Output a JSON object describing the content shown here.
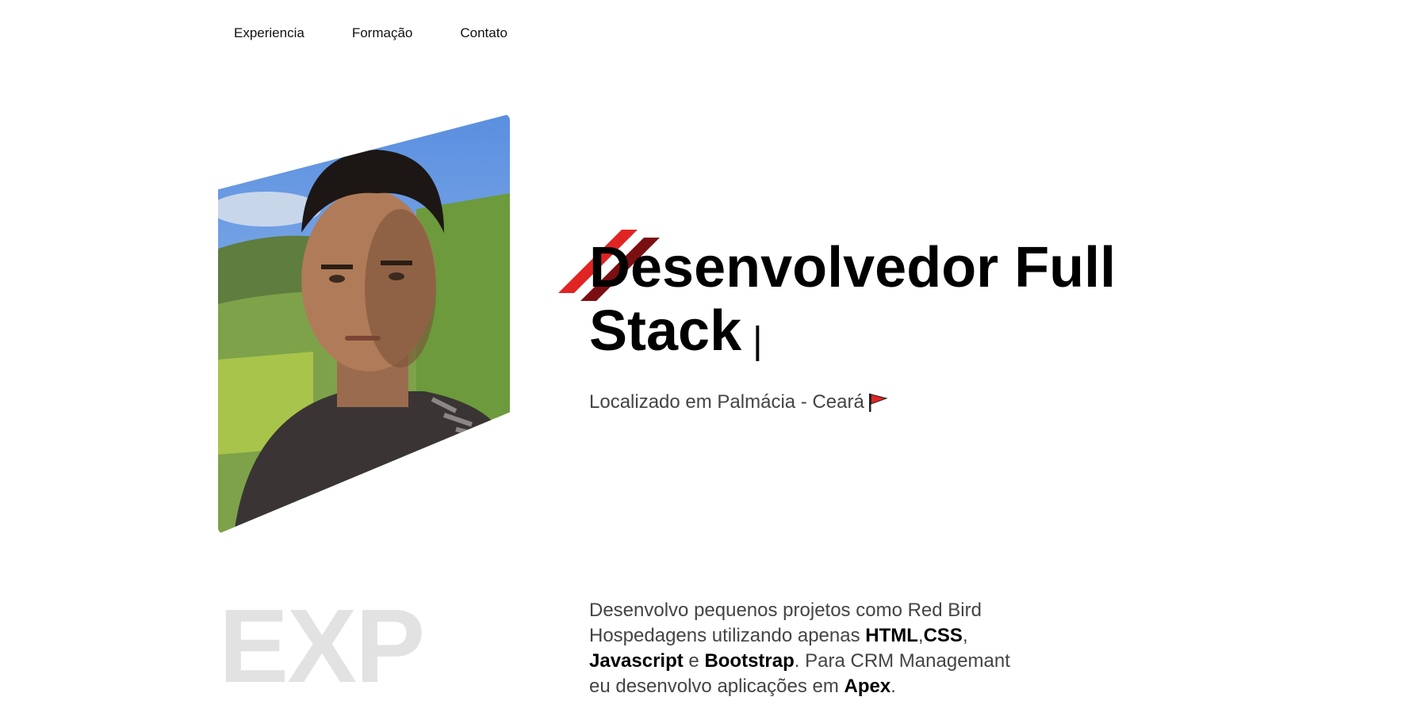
{
  "nav": {
    "items": [
      {
        "label": "Experiencia"
      },
      {
        "label": "Formação"
      },
      {
        "label": "Contato"
      }
    ]
  },
  "hero": {
    "title": "Desenvolvedor Full Stack",
    "caret": "|",
    "location": "Localizado em Palmácia - Ceará",
    "flag_icon": "red-flag-icon",
    "accent_colors": {
      "light_red": "#e02424",
      "dark_red": "#7a0f12"
    }
  },
  "experience": {
    "big_label": "EXP",
    "description": {
      "t1": "Desenvolvo pequenos projetos como Red Bird Hospedagens utilizando apenas ",
      "html": "HTML",
      "comma1": ",",
      "css": "CSS",
      "comma2": ", ",
      "js": "Javascript",
      "and": " e ",
      "bootstrap": "Bootstrap",
      "t2": ". Para CRM Managemant eu desenvolvo aplicações em ",
      "apex": "Apex",
      "t3": "."
    }
  }
}
